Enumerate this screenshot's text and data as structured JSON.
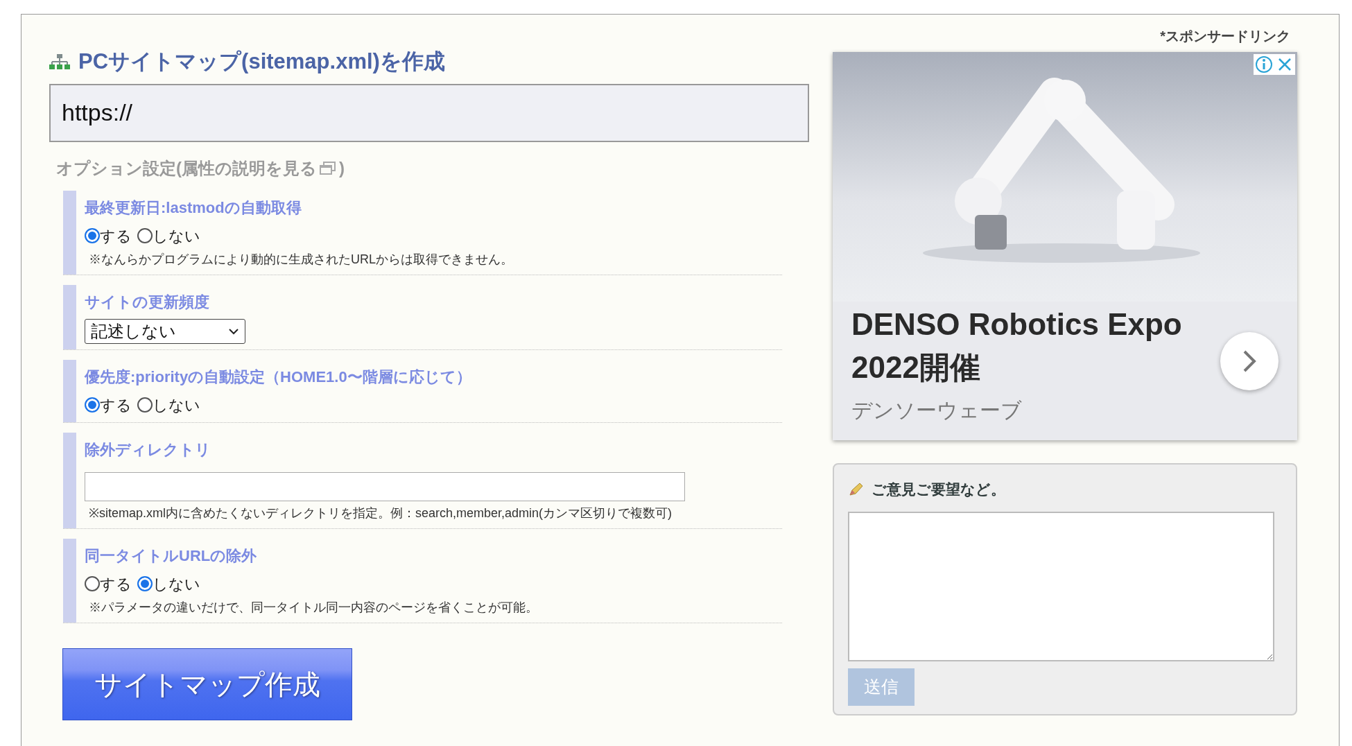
{
  "title": "PCサイトマップ(sitemap.xml)を作成",
  "url_field": {
    "value": "https://"
  },
  "options_heading": {
    "text": "オプション設定(属性の説明を見る",
    "closing": ")"
  },
  "options": [
    {
      "kind": "radio",
      "label": "最終更新日:lastmodの自動取得",
      "choices": [
        {
          "label": "する",
          "selected": true
        },
        {
          "label": "しない",
          "selected": false
        }
      ],
      "note": "※なんらかプログラムにより動的に生成されたURLからは取得できません。"
    },
    {
      "kind": "select",
      "label": "サイトの更新頻度",
      "value": "記述しない"
    },
    {
      "kind": "radio",
      "label": "優先度:priorityの自動設定（HOME1.0〜階層に応じて）",
      "choices": [
        {
          "label": "する",
          "selected": true
        },
        {
          "label": "しない",
          "selected": false
        }
      ]
    },
    {
      "kind": "text",
      "label": "除外ディレクトリ",
      "note": "※sitemap.xml内に含めたくないディレクトリを指定。例：search,member,admin(カンマ区切りで複数可)"
    },
    {
      "kind": "radio",
      "label": "同一タイトルURLの除外",
      "choices": [
        {
          "label": "する",
          "selected": false
        },
        {
          "label": "しない",
          "selected": true
        }
      ],
      "note": "※パラメータの違いだけで、同一タイトル同一内容のページを省くことが可能。"
    }
  ],
  "submit_button": "サイトマップ作成",
  "sponsor_label": "*スポンサードリンク",
  "ad": {
    "headline": "DENSO Robotics Expo 2022開催",
    "advertiser": "デンソーウェーブ"
  },
  "feedback": {
    "heading": "ご意見ご要望など。",
    "button": "送信"
  }
}
